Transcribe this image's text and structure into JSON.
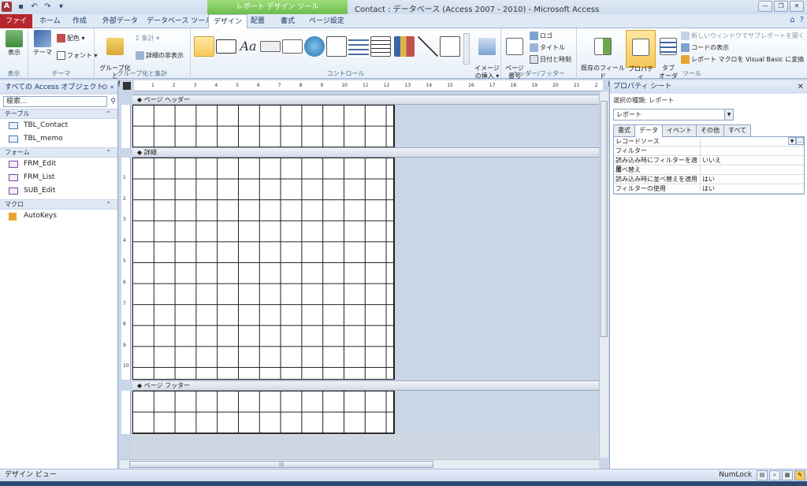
{
  "window": {
    "title": "Contact : データベース (Access 2007 - 2010) - Microsoft Access",
    "context_tab_group": "レポート デザイン ツール",
    "app_icon": "A"
  },
  "tabs": [
    "ファイル",
    "ホーム",
    "作成",
    "外部データ",
    "データベース ツール",
    "デザイン",
    "配置",
    "書式",
    "ページ設定"
  ],
  "ribbon": {
    "views": {
      "label": "表示",
      "button": "表示"
    },
    "themes": {
      "label": "テーマ",
      "theme": "テーマ",
      "colors": "配色 ▾",
      "fonts": "フォント ▾"
    },
    "grouping": {
      "label": "グループ化と集計",
      "group_sort": "グループ化と\n並べ替え",
      "totals": "Σ 集計 ▾",
      "hide_details": "詳細の非表示"
    },
    "controls": {
      "label": "コントロール",
      "insert_image": "イメージ\nの挿入 ▾"
    },
    "header_footer": {
      "label": "ヘッダー/フッター",
      "page_numbers": "ページ\n番号",
      "logo": "ロゴ",
      "title": "タイトル",
      "date_time": "日付と時刻"
    },
    "tools": {
      "label": "ツール",
      "add_fields": "既存のフィールド\nの追加",
      "property_sheet": "プロパティ\nシート",
      "tab_order": "タブ\nオーダー",
      "new_subreport": "新しいウィンドウでサブレポートを開く",
      "view_code": "コードの表示",
      "convert_macros": "レポート マクロを Visual Basic に変換"
    }
  },
  "nav": {
    "header": "すべての Access オブジェクト",
    "search_placeholder": "検索...",
    "groups": [
      {
        "name": "テーブル",
        "items": [
          "TBL_Contact",
          "TBL_memo"
        ]
      },
      {
        "name": "フォーム",
        "items": [
          "FRM_Edit",
          "FRM_List",
          "SUB_Edit"
        ]
      },
      {
        "name": "マクロ",
        "items": [
          "AutoKeys"
        ]
      }
    ]
  },
  "design": {
    "sections": {
      "page_header": "ページ ヘッダー",
      "detail": "詳細",
      "page_footer": "ページ フッター"
    },
    "ruler_ticks": [
      "1",
      "2",
      "3",
      "4",
      "5",
      "6",
      "7",
      "8",
      "9",
      "10",
      "11",
      "12",
      "13",
      "14",
      "15",
      "16",
      "17",
      "18",
      "19",
      "20",
      "21",
      "2"
    ],
    "left_ruler": [
      "1",
      "2",
      "3",
      "4",
      "5",
      "6",
      "7",
      "8",
      "9",
      "10"
    ],
    "hscroll_grip": "|||"
  },
  "property_sheet": {
    "title": "プロパティ シート",
    "selection_type_label": "選択の種類: レポート",
    "selected_object": "レポート",
    "tabs": [
      "書式",
      "データ",
      "イベント",
      "その他",
      "すべて"
    ],
    "active_tab": "データ",
    "rows": [
      {
        "name": "レコードソース",
        "value": ""
      },
      {
        "name": "フィルター",
        "value": ""
      },
      {
        "name": "読み込み時にフィルターを適用",
        "value": "いいえ"
      },
      {
        "name": "並べ替え",
        "value": ""
      },
      {
        "name": "読み込み時に並べ替えを適用",
        "value": "はい"
      },
      {
        "name": "フィルターの使用",
        "value": "はい"
      }
    ]
  },
  "status": {
    "left": "デザイン ビュー",
    "right": "NumLock"
  }
}
